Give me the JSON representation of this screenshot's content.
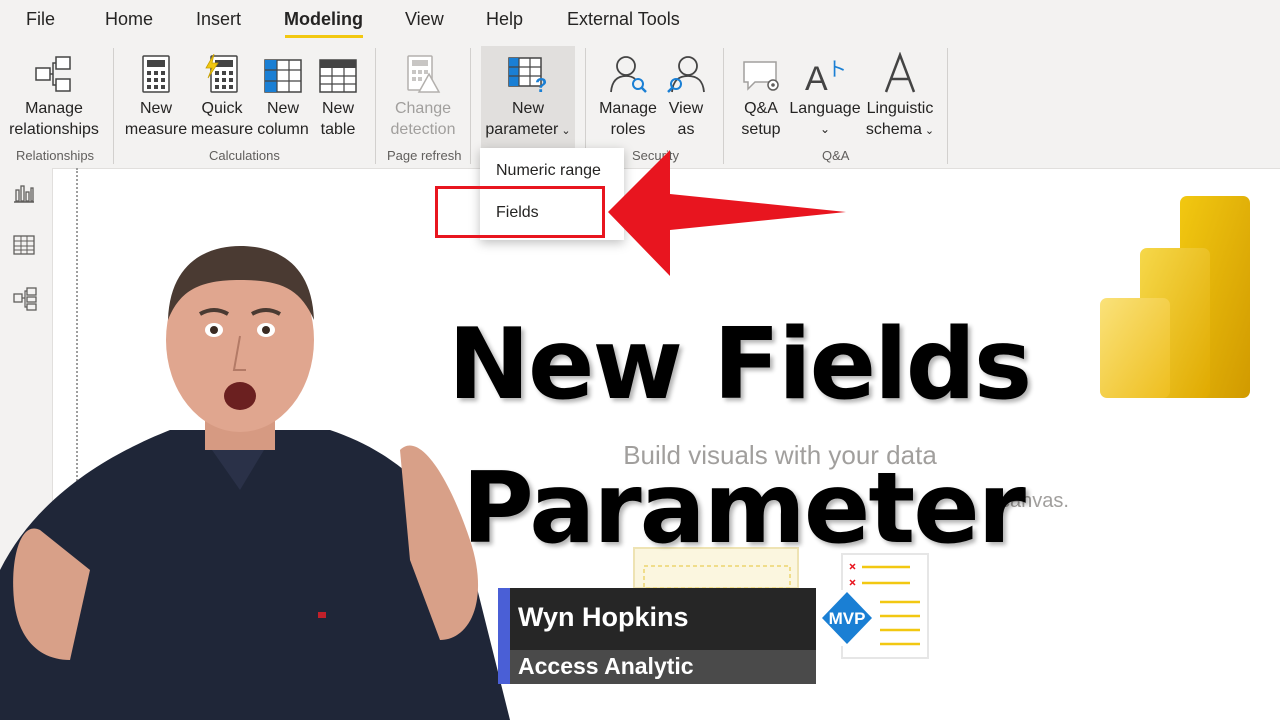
{
  "menu": {
    "items": [
      "File",
      "Home",
      "Insert",
      "Modeling",
      "View",
      "Help",
      "External Tools"
    ],
    "active": "Modeling"
  },
  "ribbon": {
    "groups": {
      "relationships": "Relationships",
      "calculations": "Calculations",
      "page_refresh": "Page refresh",
      "security": "Security",
      "qa": "Q&A"
    },
    "buttons": {
      "manage_relationships": [
        "Manage",
        "relationships"
      ],
      "new_measure": [
        "New",
        "measure"
      ],
      "quick_measure": [
        "Quick",
        "measure"
      ],
      "new_column": [
        "New",
        "column"
      ],
      "new_table": [
        "New",
        "table"
      ],
      "change_detection": [
        "Change",
        "detection"
      ],
      "new_parameter": [
        "New",
        "parameter"
      ],
      "manage_roles": [
        "Manage",
        "roles"
      ],
      "view_as": [
        "View",
        "as"
      ],
      "qa_setup": [
        "Q&A",
        "setup"
      ],
      "language": [
        "Language",
        ""
      ],
      "linguistic_schema": [
        "Linguistic",
        "schema"
      ]
    }
  },
  "dropdown": {
    "items": [
      "Numeric range",
      "Fields"
    ]
  },
  "canvas": {
    "heading": "Build visuals with your data",
    "subtext": "canvas."
  },
  "overlay": {
    "title_line1": "New Fields",
    "title_line2": "Parameter"
  },
  "nameplate": {
    "name": "Wyn Hopkins",
    "company": "Access Analytic",
    "badge": "MVP"
  },
  "colors": {
    "accent_yellow": "#f2c811",
    "arrow_red": "#e8151f",
    "nameplate_blue": "#4a5fd6",
    "mvp_blue": "#1a7fd4"
  }
}
